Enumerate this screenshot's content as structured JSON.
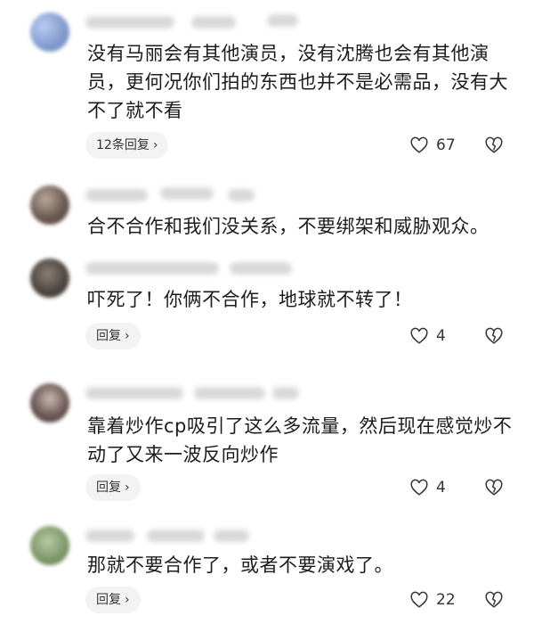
{
  "comments": [
    {
      "text": "没有马丽会有其他演员，没有沈腾也会有其他演员，更何况你们拍的东西也并不是必需品，没有大不了就不看",
      "reply_label": "12条回复",
      "likes": "67",
      "avatar_color": "#8aa6d6"
    },
    {
      "text": "合不合作和我们没关系，不要绑架和威胁观众。",
      "avatar_color": "#7a6a62"
    },
    {
      "text": "吓死了！你俩不合作，地球就不转了！",
      "reply_label": "回复",
      "likes": "4",
      "avatar_color": "#5e5650"
    },
    {
      "text": "靠着炒作cp吸引了这么多流量，然后现在感觉炒不动了又来一波反向炒作",
      "reply_label": "回复",
      "likes": "4",
      "avatar_color": "#6d5a58"
    },
    {
      "text": "那就不要合作了，或者不要演戏了。",
      "reply_label": "回复",
      "likes": "22",
      "avatar_color": "#7f9a6a"
    }
  ],
  "icons": {
    "chevron": "›",
    "like": "heart-outline-icon",
    "dislike": "broken-heart-icon"
  }
}
